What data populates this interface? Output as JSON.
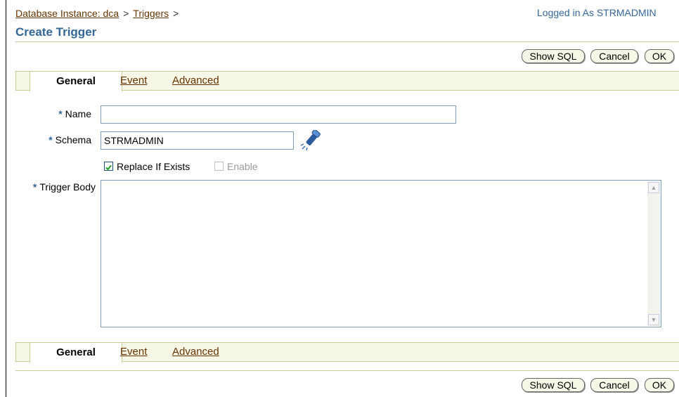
{
  "breadcrumb": {
    "items": [
      "Database Instance: dca",
      "Triggers"
    ],
    "separator": ">"
  },
  "header": {
    "logged_in": "Logged in As STRMADMIN",
    "title": "Create Trigger"
  },
  "buttons": {
    "show_sql": "Show SQL",
    "cancel": "Cancel",
    "ok": "OK"
  },
  "tabs": [
    {
      "label": "General",
      "active": true
    },
    {
      "label": "Event",
      "active": false
    },
    {
      "label": "Advanced",
      "active": false
    }
  ],
  "form": {
    "required_marker": "*",
    "name_label": "Name",
    "name_value": "",
    "schema_label": "Schema",
    "schema_value": "STRMADMIN",
    "replace_label": "Replace If Exists",
    "replace_checked": true,
    "enable_label": "Enable",
    "enable_checked": false,
    "enable_disabled": true,
    "body_label": "Trigger Body",
    "body_value": ""
  },
  "icons": {
    "search": "flashlight-icon"
  },
  "colors": {
    "link": "#663300",
    "title": "#336699",
    "tab_bar": "#f7f7e7",
    "rule": "#cccc99"
  }
}
